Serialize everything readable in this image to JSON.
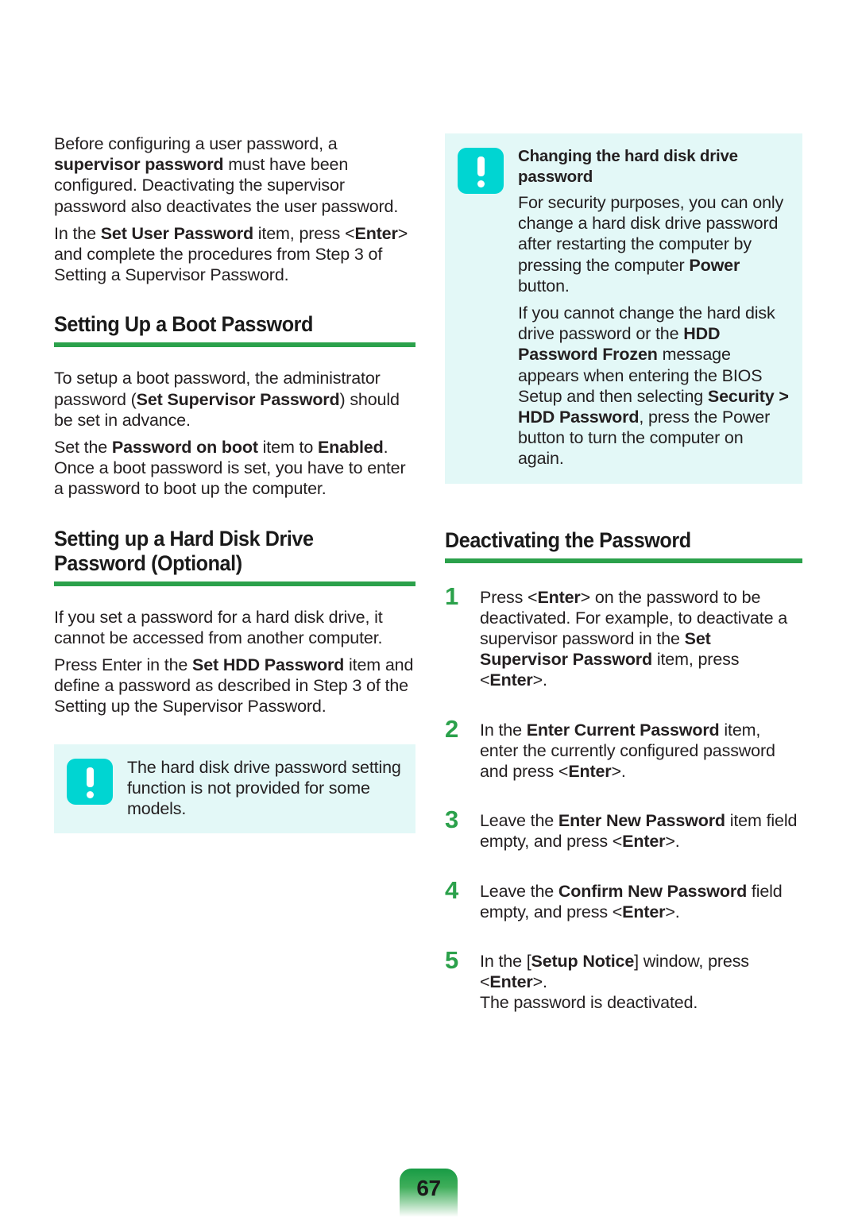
{
  "page": {
    "number": "67",
    "accent_green": "#2ba14b",
    "note_bg": "#e3f8f7",
    "note_icon_color": "#00d5d2",
    "text_color": "#231f20"
  },
  "left_column": {
    "intro": {
      "p1_a": "Before configuring a user password, a ",
      "p1_b": "supervisor password",
      "p1_c": " must have been configured. Deactivating the supervisor password also deactivates the user password.",
      "p2_a": "In the ",
      "p2_b": "Set User Password",
      "p2_c": " item, press <",
      "p2_d": "Enter",
      "p2_e": "> and complete the procedures from Step 3 of Setting a Supervisor Password."
    },
    "boot_section": {
      "heading": "Setting Up a Boot Password",
      "p1_a": "To setup a boot password, the administrator password (",
      "p1_b": "Set Supervisor Password",
      "p1_c": ") should be set in advance.",
      "p2_a": "Set the ",
      "p2_b": "Password on boot",
      "p2_c": " item to ",
      "p2_d": "Enabled",
      "p2_e": ". Once a boot password is set, you have to enter a password to boot up the computer."
    },
    "hdd_section": {
      "heading": "Setting up a Hard Disk Drive Password (Optional)",
      "p1": "If you set a password for a hard disk drive, it cannot be accessed from another computer.",
      "p2_a": "Press Enter in the ",
      "p2_b": "Set HDD Password",
      "p2_c": " item and define a password as described in Step 3 of the Setting up the Supervisor Password."
    },
    "note": {
      "icon": "exclamation-icon",
      "text": "The hard disk drive password setting function is not provided for some models."
    }
  },
  "right_column": {
    "note": {
      "icon": "exclamation-icon",
      "title": "Changing the hard disk drive password",
      "p1_a": "For security purposes, you can only change a hard disk drive password after restarting the computer by pressing the computer ",
      "p1_b": "Power",
      "p1_c": " button.",
      "p2_a": "If you cannot change the hard disk drive password or the ",
      "p2_b": "HDD Password Frozen",
      "p2_c": " message appears when entering the BIOS Setup and then selecting ",
      "p2_d": "Security > HDD Password",
      "p2_e": ", press the Power button to turn the computer on again."
    },
    "deactivate_section": {
      "heading": "Deactivating the Password",
      "steps": [
        {
          "number": "1",
          "a": "Press <",
          "b": "Enter",
          "c": "> on the password to be deactivated. For example, to deactivate a supervisor password in the ",
          "d": "Set Supervisor Password",
          "e": " item, press <",
          "f": "Enter",
          "g": ">."
        },
        {
          "number": "2",
          "a": "In the ",
          "b": "Enter Current Password",
          "c": " item, enter the currently configured password and press <",
          "d": "Enter",
          "e": ">."
        },
        {
          "number": "3",
          "a": "Leave the ",
          "b": "Enter New Password",
          "c": " item field empty, and press <",
          "d": "Enter",
          "e": ">."
        },
        {
          "number": "4",
          "a": "Leave the ",
          "b": "Confirm New Password",
          "c": " field empty, and press <",
          "d": "Enter",
          "e": ">."
        },
        {
          "number": "5",
          "a": "In the [",
          "b": "Setup Notice",
          "c": "] window, press <",
          "d": "Enter",
          "e": ">.",
          "f": "The password is deactivated."
        }
      ]
    }
  }
}
